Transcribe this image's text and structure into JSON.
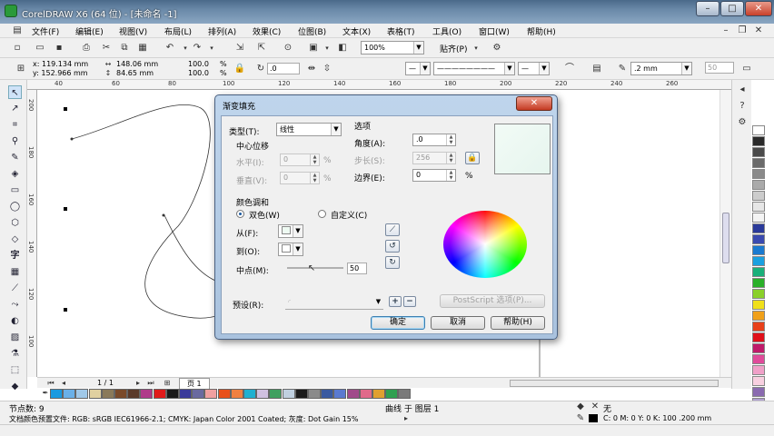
{
  "app": {
    "title": "CorelDRAW X6 (64 位) - [未命名 -1]"
  },
  "window_buttons": [
    "–",
    "□",
    "✕"
  ],
  "menu": [
    "文件(F)",
    "编辑(E)",
    "视图(V)",
    "布局(L)",
    "排列(A)",
    "效果(C)",
    "位图(B)",
    "文本(X)",
    "表格(T)",
    "工具(O)",
    "窗口(W)",
    "帮助(H)"
  ],
  "standard_toolbar": {
    "zoom": "100%",
    "snap": "贴齐(P)"
  },
  "property_bar": {
    "x": "x: 119.134 mm",
    "y": "y: 152.966 mm",
    "w": "148.06 mm",
    "h": "84.65 mm",
    "sx": "100.0",
    "sy": "100.0",
    "pct1": "%",
    "pct2": "%",
    "angle": ".0",
    "outline": ".2 mm",
    "smooth": "50"
  },
  "ruler_h": [
    "40",
    "60",
    "80",
    "100",
    "120",
    "140",
    "160",
    "180",
    "200",
    "220",
    "240",
    "260"
  ],
  "ruler_v": [
    "200",
    "180",
    "160",
    "140",
    "120",
    "100"
  ],
  "dialog": {
    "title": "渐变填充",
    "type_label": "类型(T):",
    "type_value": "线性",
    "options_label": "选项",
    "center_offset": "中心位移",
    "horizontal_label": "水平(I):",
    "horizontal_value": "0",
    "vertical_label": "垂直(V):",
    "vertical_value": "0",
    "pct": "%",
    "angle_label": "角度(A):",
    "angle_value": ".0",
    "steps_label": "步长(S):",
    "steps_value": "256",
    "edge_label": "边界(E):",
    "edge_value": "0",
    "blend_title": "颜色调和",
    "two_color": "双色(W)",
    "custom": "自定义(C)",
    "from_label": "从(F):",
    "to_label": "到(O):",
    "midpoint_label": "中点(M):",
    "midpoint_value": "50",
    "presets_label": "预设(R):",
    "postscript_btn": "PostScript 选项(P)...",
    "ok": "确定",
    "cancel": "取消",
    "help": "帮助(H)"
  },
  "page_nav": {
    "count": "1 / 1",
    "tab": "页 1"
  },
  "status": {
    "nodes": "节点数: 9",
    "curve": "曲线 于 图层 1",
    "fill_none": "无",
    "profile": "文档颜色预置文件: RGB: sRGB IEC61966-2.1; CMYK: Japan Color 2001 Coated; 灰度: Dot Gain 15%",
    "outline_info": "C: 0 M: 0 Y: 0 K: 100  .200 mm"
  },
  "palette_vertical": [
    "#ffffff",
    "#2a2a2a",
    "#4a4a4a",
    "#6a6a6a",
    "#8a8a8a",
    "#aaaaaa",
    "#cccccc",
    "#e6e6e6",
    "#f4f4f4",
    "#2a3a9a",
    "#3a4ab0",
    "#1a7ad0",
    "#1aa0e0",
    "#1ab07a",
    "#2ab02a",
    "#8ad02a",
    "#f0e01a",
    "#f0a01a",
    "#e8401a",
    "#e0101a",
    "#c01a6a",
    "#e04a9a",
    "#f0a0c8",
    "#f8d0e0",
    "#8a6ab0",
    "#b0a0d0",
    "#f8f0a0"
  ],
  "palette_horizontal": [
    "#1a9ae0",
    "#6ab0e8",
    "#a0c8e8",
    "#e0d0a0",
    "#8a7a5a",
    "#7a4a2a",
    "#5a3a2a",
    "#b03a8a",
    "#e01a1a",
    "#1a1a1a",
    "#3a3a9a",
    "#6a6aa0",
    "#f0a0a0",
    "#e8501a",
    "#f08040",
    "#20b0d0",
    "#d0c0e0",
    "#40a060",
    "#c0d0e0",
    "#1a1a1a",
    "#8a8a8a",
    "#3a5aa0",
    "#5a7ad0",
    "#a04a8a",
    "#e06a8a",
    "#e0a030",
    "#30a050",
    "#7a7a7a"
  ]
}
